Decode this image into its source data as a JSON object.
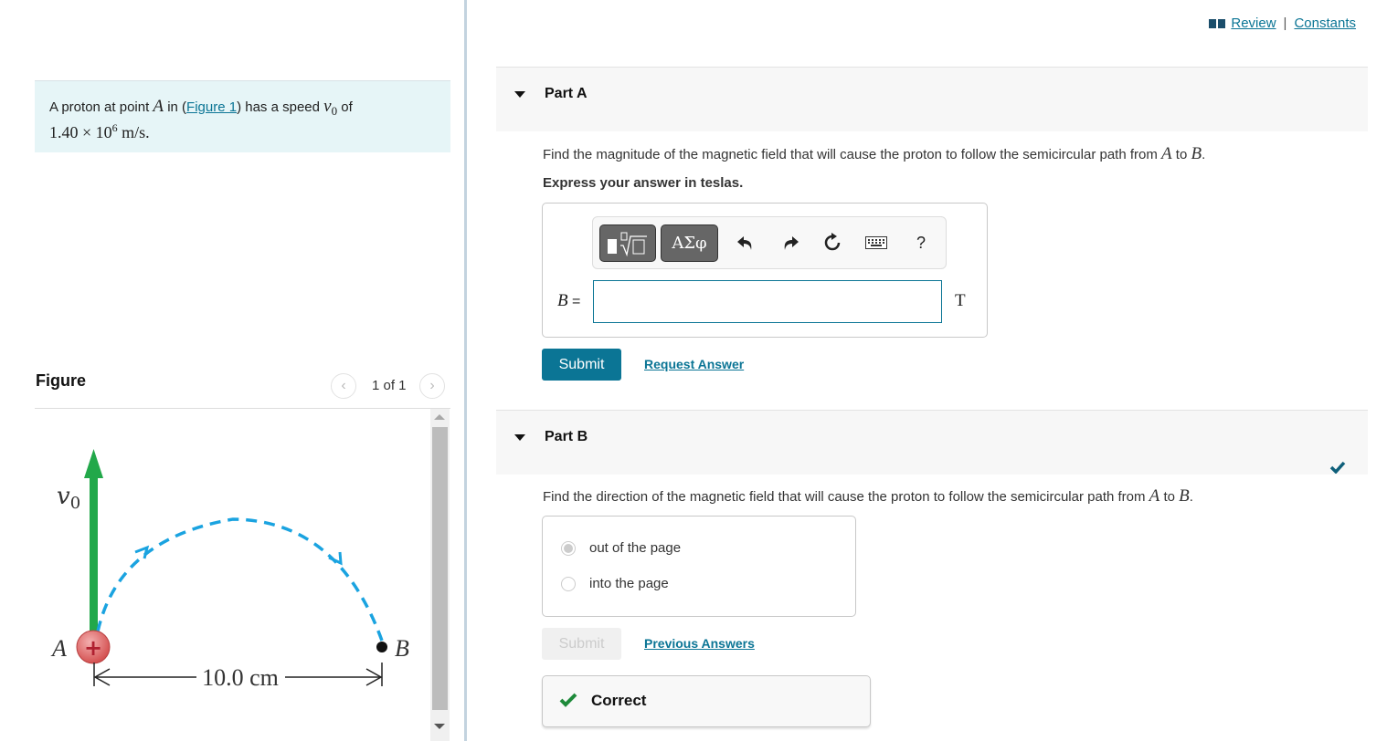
{
  "topnav": {
    "review_label": "Review",
    "separator": "|",
    "constants_label": "Constants",
    "icon": "book-icon"
  },
  "problem": {
    "text_before": "A proton at point ",
    "point_a": "A",
    "text_in": " in (",
    "figure_link": "Figure 1",
    "text_after": ") has a speed ",
    "speed_symbol": "v",
    "speed_subscript": "0",
    "text_of": " of",
    "speed_value_mantissa": "1.40 × 10",
    "speed_value_exponent": "6",
    "speed_value_unit": " m/s."
  },
  "figure": {
    "title": "Figure",
    "pager_text": "1 of 1",
    "prev_icon": "chevron-left-icon",
    "next_icon": "chevron-right-icon",
    "labels": {
      "velocity": "v",
      "velocity_sub": "0",
      "point_a": "A",
      "point_b": "B",
      "charge_sign": "+",
      "distance": "10.0 cm"
    },
    "colors": {
      "velocity_arrow": "#22a84a",
      "path": "#1aa3e0",
      "proton": "#d45050"
    }
  },
  "partA": {
    "title": "Part A",
    "question_prefix": "Find the magnitude of the magnetic field that will cause the proton to follow the semicircular path from ",
    "point_a": "A",
    "to": " to ",
    "point_b": "B",
    "period": ".",
    "instruction": "Express your answer in teslas.",
    "toolbar": {
      "templates_icon": "math-templates-icon",
      "greek_label": "ΑΣφ",
      "undo_icon": "undo-icon",
      "redo_icon": "redo-icon",
      "reset_icon": "reset-icon",
      "keyboard_icon": "keyboard-icon",
      "help_label": "?"
    },
    "variable": "B",
    "equals": " =",
    "input_value": "",
    "unit": "T",
    "submit_label": "Submit",
    "request_answer_label": "Request Answer"
  },
  "partB": {
    "title": "Part B",
    "completed": true,
    "question_prefix": "Find the direction of the magnetic field that will cause the proton to follow the semicircular path from ",
    "point_a": "A",
    "to": " to ",
    "point_b": "B",
    "period": ".",
    "choices": [
      {
        "label": "out of the page",
        "selected": true
      },
      {
        "label": "into the page",
        "selected": false
      }
    ],
    "submit_label": "Submit",
    "previous_answers_label": "Previous Answers",
    "feedback": "Correct"
  },
  "colors": {
    "accent": "#0b7595",
    "problem_bg": "#e6f5f7",
    "part_header_bg": "#f7f7f7",
    "correct_green": "#1e8a3a",
    "check_teal": "#0e5f7a"
  }
}
